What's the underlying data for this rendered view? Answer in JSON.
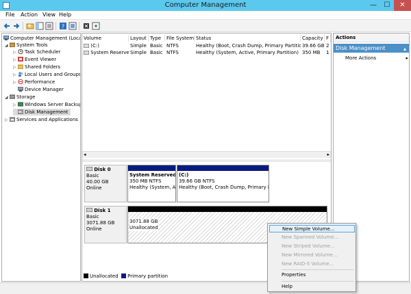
{
  "window": {
    "title": "Computer Management",
    "min": "—",
    "max": "☐",
    "close": "✕"
  },
  "menu": [
    "File",
    "Action",
    "View",
    "Help"
  ],
  "tree": [
    {
      "label": "Computer Management (Local",
      "arrow": ""
    },
    {
      "label": "System Tools",
      "arrow": "◢"
    },
    {
      "label": "Task Scheduler",
      "arrow": "▷"
    },
    {
      "label": "Event Viewer",
      "arrow": "▷"
    },
    {
      "label": "Shared Folders",
      "arrow": "▷"
    },
    {
      "label": "Local Users and Groups",
      "arrow": "▷"
    },
    {
      "label": "Performance",
      "arrow": "▷"
    },
    {
      "label": "Device Manager",
      "arrow": ""
    },
    {
      "label": "Storage",
      "arrow": "◢"
    },
    {
      "label": "Windows Server Backup",
      "arrow": "▷"
    },
    {
      "label": "Disk Management",
      "arrow": ""
    },
    {
      "label": "Services and Applications",
      "arrow": "▷"
    }
  ],
  "volume_list": {
    "headers": [
      "Volume",
      "Layout",
      "Type",
      "File System",
      "Status",
      "Capacity",
      "F"
    ],
    "rows": [
      [
        "(C:)",
        "Simple",
        "Basic",
        "NTFS",
        "Healthy (Boot, Crash Dump, Primary Partition)",
        "39.66 GB",
        "2"
      ],
      [
        "System Reserved",
        "Simple",
        "Basic",
        "NTFS",
        "Healthy (System, Active, Primary Partition)",
        "350 MB",
        "1"
      ]
    ],
    "scroll_left": "◂",
    "scroll_right": "▸"
  },
  "disks": [
    {
      "name": "Disk 0",
      "type": "Basic",
      "size": "40.00 GB",
      "status": "Online",
      "volumes": [
        {
          "name": "System Reserved",
          "info": "350 MB NTFS",
          "status": "Healthy (System, Ac"
        },
        {
          "name": "(C:)",
          "info": "39.66 GB NTFS",
          "status": "Healthy (Boot, Crash Dump, Primary Pa"
        }
      ]
    },
    {
      "name": "Disk 1",
      "type": "Basic",
      "size": "3071.88 GB",
      "status": "Online",
      "volumes": [
        {
          "name": "",
          "info": "3071.88 GB",
          "status": "Unallocated"
        }
      ]
    }
  ],
  "legend": {
    "unallocated": {
      "label": "Unallocated",
      "color": "#000000"
    },
    "primary": {
      "label": "Primary partition",
      "color": "#0a1b7f"
    }
  },
  "actions": {
    "title": "Actions",
    "section": "Disk Management",
    "section_caret": "▴",
    "more": "More Actions",
    "more_caret": "▸"
  },
  "context_menu": {
    "items": [
      {
        "label": "New Simple Volume...",
        "enabled": true
      },
      {
        "label": "New Spanned Volume...",
        "enabled": false
      },
      {
        "label": "New Striped Volume...",
        "enabled": false
      },
      {
        "label": "New Mirrored Volume...",
        "enabled": false
      },
      {
        "label": "New RAID-5 Volume...",
        "enabled": false
      },
      {
        "label": "Properties",
        "enabled": true
      },
      {
        "label": "Help",
        "enabled": true
      }
    ]
  },
  "colors": {
    "titlebar": "#5bc8ee",
    "selection": "#4c90c8",
    "close": "#c75050"
  }
}
